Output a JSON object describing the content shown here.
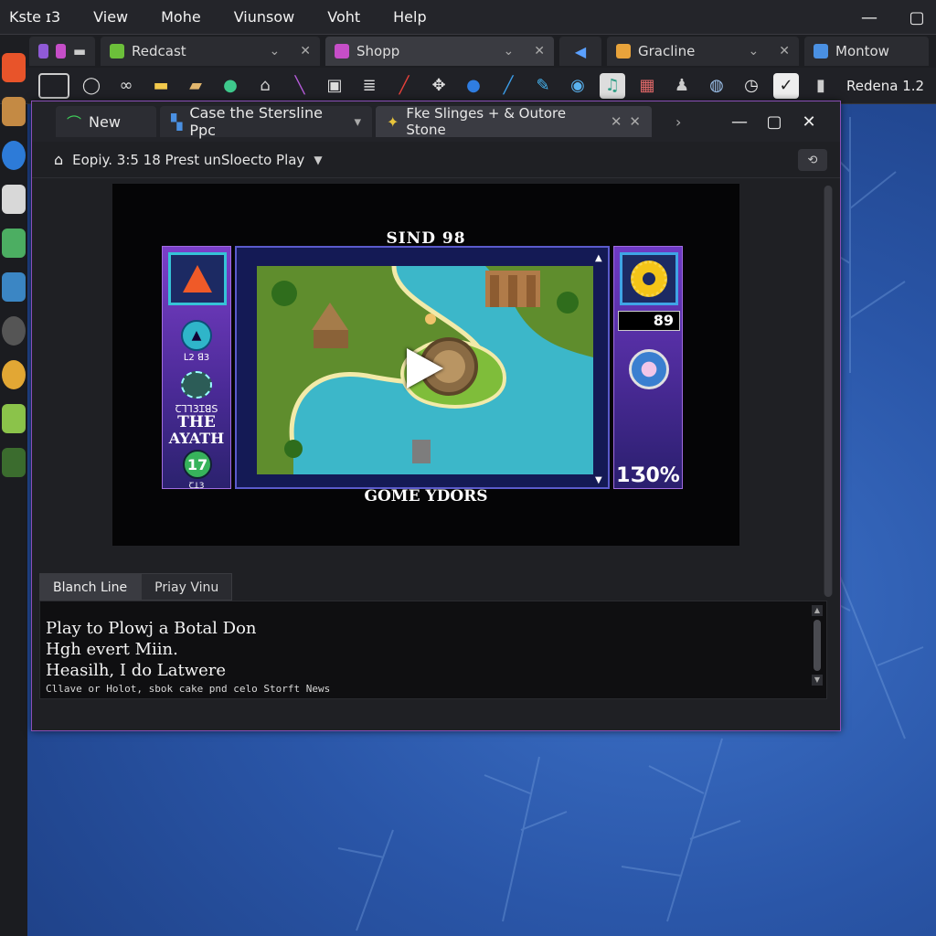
{
  "menubar": {
    "items": [
      "Kste ɪ3",
      "View",
      "Mohe",
      "Viunsow",
      "Voht",
      "Help"
    ],
    "minimize": "—",
    "maximize": "▢"
  },
  "browser_tabs": [
    {
      "label": "Redcast",
      "icon_color": "#6cbf3a"
    },
    {
      "label": "Shopp",
      "icon_color": "#c64ec8"
    },
    {
      "label": "Gracline",
      "icon_color": "#e8a33b"
    },
    {
      "label": "Montow",
      "icon_color": "#4a90e2"
    }
  ],
  "toolbar": {
    "icons": [
      "frame-icon",
      "circle-icon",
      "link-icon",
      "folder-icon",
      "folder2-icon",
      "gem-icon",
      "home-icon",
      "pen-icon",
      "screen-icon",
      "doc-icon",
      "brush-icon",
      "puzzle-icon",
      "info-icon",
      "pencil-icon",
      "pen2-icon",
      "globe-icon",
      "music-icon",
      "image-icon",
      "people-icon",
      "globe2-icon",
      "clock-icon",
      "chat-icon",
      "trash-icon"
    ],
    "right_label": "Redena 1.2"
  },
  "window": {
    "tabs": [
      {
        "label": "New"
      },
      {
        "label": "Case the Stersline Ppc"
      },
      {
        "label": "Fke Slinges + & Outore Stone"
      }
    ],
    "controls": {
      "minimize": "—",
      "maximize": "▢",
      "close": "✕"
    },
    "address": "Eopiy. 3:5 18 Prest unSloecto Play"
  },
  "game": {
    "title": "SIND 98",
    "subtitle": "GOME YDORS",
    "left_panel": {
      "label_small_1": "ꓡ2 ꓭ3",
      "label_small_2": "Ꞇꓶꓶ3Ɪꓭꓢ",
      "big_1": "THE",
      "big_2": "AYATH",
      "level": "17",
      "label_small_3": "Ꞇꓕ3"
    },
    "right_panel": {
      "score": "89",
      "percent": "1Ʒ0%"
    }
  },
  "panel_tabs": [
    "Blanch Line",
    "Priay Vinu"
  ],
  "log": {
    "lines": [
      "Play to Plowj a Botal Don",
      "Hgh evert Miin.",
      "Heasilh, I do Latwere"
    ],
    "small_line": "Cllave or Holot, sbok cake pnd celo Storft News"
  },
  "colors": {
    "window_border": "#8a4fb8",
    "desktop": "#2a56a8",
    "panel_purple": "#7b3fc9"
  }
}
